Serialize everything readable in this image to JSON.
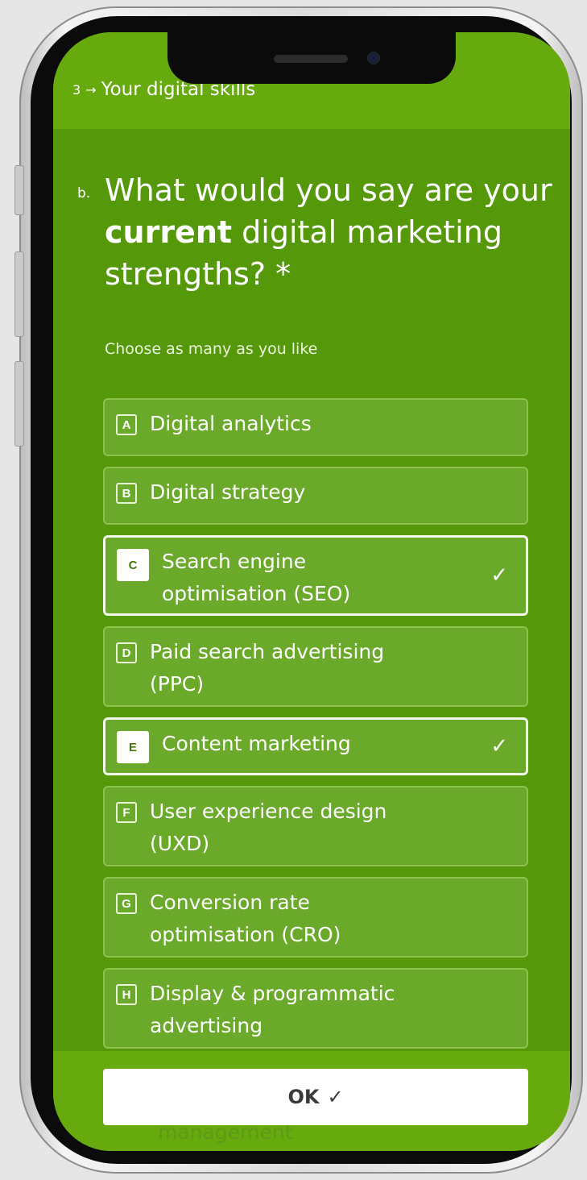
{
  "progress": {
    "section_number": "3",
    "arrow": "→",
    "label": "Your digital skills"
  },
  "question": {
    "letter": "b.",
    "text_before": "What would you say are your ",
    "text_bold": "current",
    "text_after": " digital marketing strengths? *"
  },
  "hint": "Choose as many as you like",
  "options": [
    {
      "key": "A",
      "label": "Digital analytics",
      "selected": false
    },
    {
      "key": "B",
      "label": "Digital strategy",
      "selected": false
    },
    {
      "key": "C",
      "label": "Search engine optimisation (SEO)",
      "selected": true
    },
    {
      "key": "D",
      "label": "Paid search advertising (PPC)",
      "selected": false
    },
    {
      "key": "E",
      "label": "Content marketing",
      "selected": true
    },
    {
      "key": "F",
      "label": "User experience design (UXD)",
      "selected": false
    },
    {
      "key": "G",
      "label": "Conversion rate optimisation (CRO)",
      "selected": false
    },
    {
      "key": "H",
      "label": "Display & programmatic advertising",
      "selected": false
    }
  ],
  "check_glyph": "✓",
  "next_option_partial": "management",
  "ok_button": {
    "label": "OK",
    "icon": "✓"
  }
}
